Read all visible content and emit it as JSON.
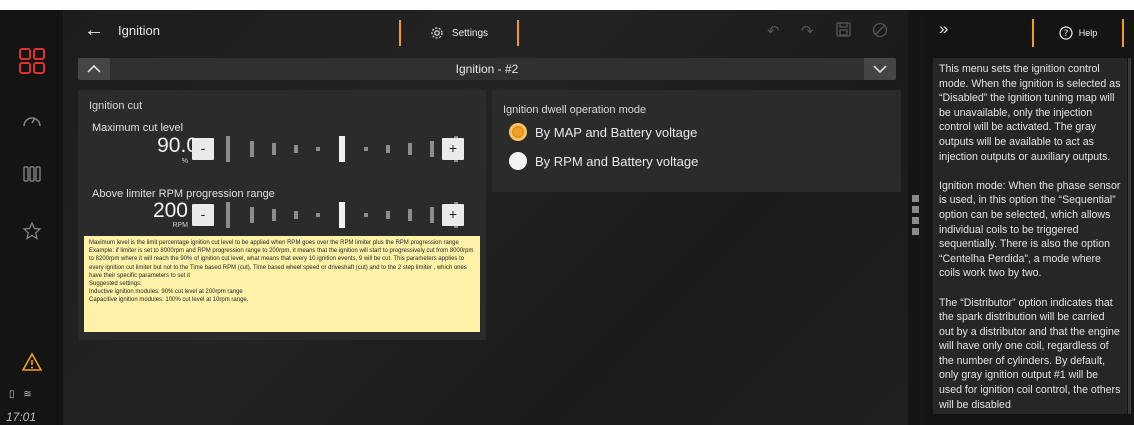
{
  "page": {
    "title": "Ignition",
    "settings_label": "Settings",
    "section_title": "Ignition - #2"
  },
  "rail": {
    "time": "17:01",
    "status": "▯ ≋"
  },
  "ignition_cut": {
    "title": "Ignition cut",
    "max_cut": {
      "label": "Maximum cut level",
      "value": "90.0",
      "unit": "%",
      "minus": "-",
      "plus": "+"
    },
    "rpm_range": {
      "label": "Above limiter RPM progression range",
      "value": "200",
      "unit": "RPM",
      "minus": "-",
      "plus": "+"
    },
    "note": "Maximum level is the limit percentage ignition cut level to be applied when RPM goes over the RPM limiter plus the RPM progression range Example: if limiter is set to 8000rpm and RPM progression range to 200rpm, it means that the ignition will start to progressively cut from 8000rpm to 8200rpm where it will reach the 90% of ignition cut level, what means that every 10 ignition events, 9 will be cut. This parameters applies to every ignition cut limiter but not to the Time based RPM (cut), Time based wheel speed or driveshaft (cut) and to the 2 step limiter , which ones have their specific parameters to set it\nSuggested settings:\nInductive ignition modules: 90% cut level at 200rpm range\nCapacitive ignition modules: 100% cut level at 10rpm range."
  },
  "dwell": {
    "title": "Ignition dwell operation mode",
    "options": [
      {
        "label": "By MAP and Battery voltage",
        "selected": true
      },
      {
        "label": "By RPM and Battery voltage",
        "selected": false
      }
    ]
  },
  "help": {
    "label": "Help",
    "text": "This menu sets the ignition control mode. When the ignition is selected as “Disabled” the ignition tuning map will be unavailable, only the injection control will be activated. The gray outputs will be available to act as injection outputs or auxiliary outputs.\n\nIgnition mode: When the phase sensor is used, in this option the “Sequential” option can be selected, which allows individual coils to be triggered sequentially. There is also the option “Centelha Perdida”, a mode where coils work two by two.\n\nThe “Distributor” option indicates that the spark distribution will be carried out by a distributor and that the engine will have only one coil, regardless of the number of cylinders. By default, only gray ignition output #1 will be used for ignition coil control, the others will be disabled"
  },
  "colors": {
    "accent": "#f0a020",
    "brand_red": "#e03030",
    "note_bg": "#fdf2a8"
  },
  "icons": [
    "dashboard-grid-icon",
    "gauge-icon",
    "columns-icon",
    "star-icon",
    "warning-icon",
    "back-arrow-icon",
    "gear-icon",
    "undo-icon",
    "redo-icon",
    "save-icon",
    "disable-icon",
    "chevron-up-icon",
    "chevron-down-icon",
    "double-chevron-right-icon",
    "help-circle-icon"
  ]
}
